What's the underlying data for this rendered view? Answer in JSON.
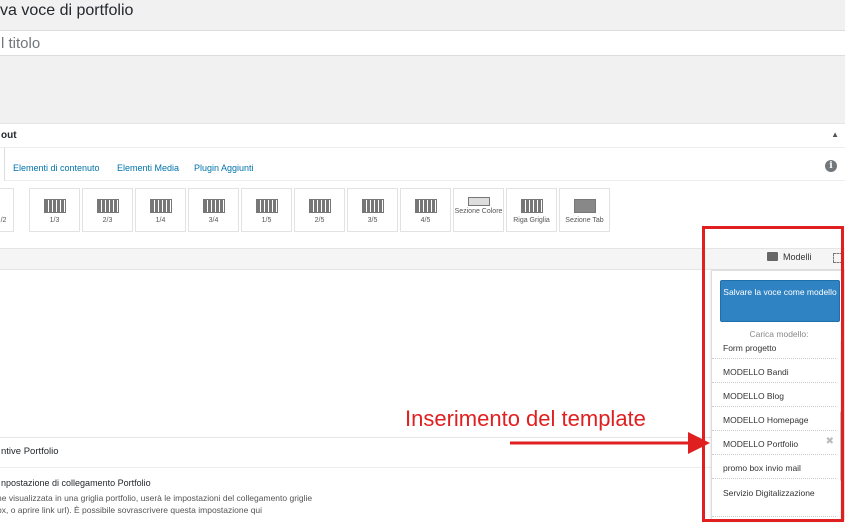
{
  "page": {
    "title": "va voce di portfolio",
    "title_placeholder": "l titolo"
  },
  "builder": {
    "header": "out",
    "toggle": "▲",
    "tabs": [
      {
        "label": "Elementi di contenuto"
      },
      {
        "label": "Elementi Media"
      },
      {
        "label": "Plugin Aggiunti"
      }
    ],
    "info_icon": "i",
    "layouts": [
      {
        "label": "/2"
      },
      {
        "label": "1/3"
      },
      {
        "label": "2/3"
      },
      {
        "label": "1/4"
      },
      {
        "label": "3/4"
      },
      {
        "label": "1/5"
      },
      {
        "label": "2/5"
      },
      {
        "label": "3/5"
      },
      {
        "label": "4/5"
      },
      {
        "label": "Sezione Colore"
      },
      {
        "label": "Riga Griglia"
      },
      {
        "label": "Sezione Tab"
      }
    ],
    "modelli_label": "Modelli"
  },
  "dropdown": {
    "save_label": "Salvare la voce come modello",
    "load_label": "Carica modello:",
    "models": [
      {
        "label": "Form progetto"
      },
      {
        "label": "MODELLO Bandi"
      },
      {
        "label": "MODELLO Blog"
      },
      {
        "label": "MODELLO Homepage"
      },
      {
        "label": "MODELLO Portfolio",
        "delete": "✖"
      },
      {
        "label": "promo box invio mail"
      },
      {
        "label": "Servizio Digitalizzazione"
      }
    ]
  },
  "lower": {
    "title": "ntive Portfolio",
    "label": "npostazione di collegamento Portfolio",
    "desc_line1": "ne visualizzata in una griglia portfolio, userà le impostazioni del collegamento griglie",
    "desc_line2": "ox, o aprire link url). È possibile sovrascrivere questa impostazione qui"
  },
  "annotation": {
    "text": "Inserimento del template",
    "color": "#e02020"
  }
}
